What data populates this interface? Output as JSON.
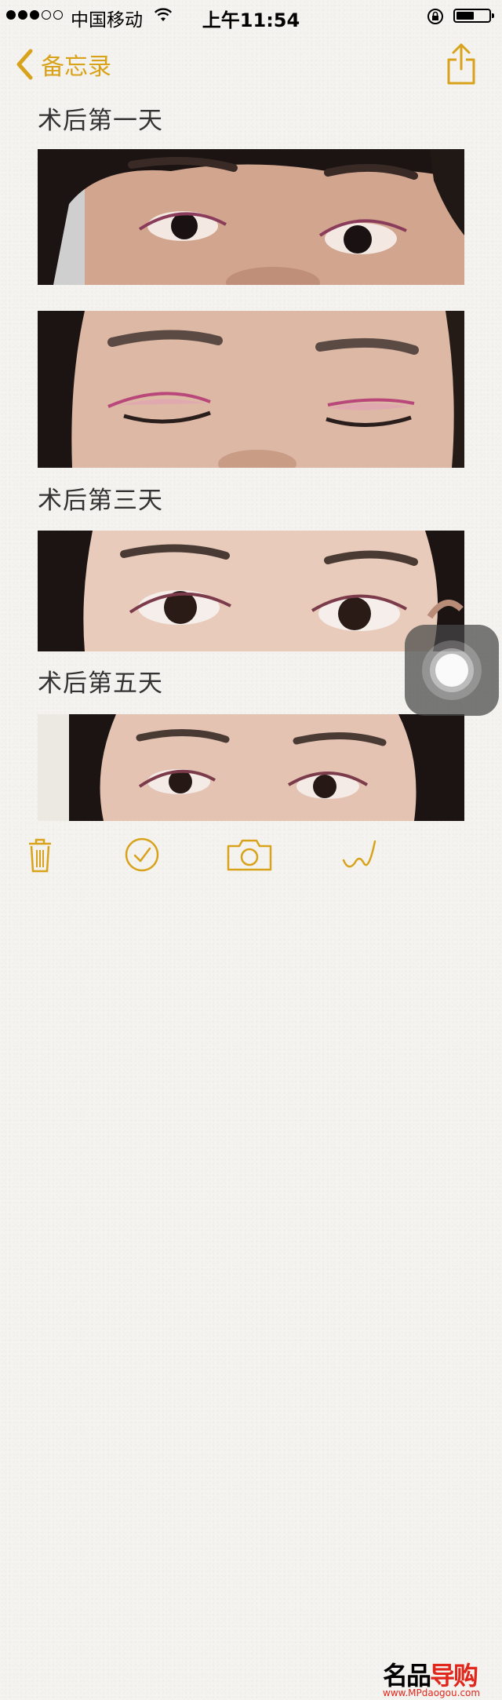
{
  "status_bar": {
    "carrier": "中国移动",
    "time": "上午11:54",
    "signal_bars_filled": 3,
    "signal_bars_total": 5,
    "battery_level": 0.45
  },
  "nav": {
    "back_label": "备忘录",
    "back_icon": "chevron-left-icon",
    "share_icon": "share-icon",
    "accent": "#d9a21b"
  },
  "note": {
    "headings": {
      "day1": "术后第一天",
      "day3": "术后第三天",
      "day5": "术后第五天"
    }
  },
  "toolbar": {
    "icons": [
      "trash-icon",
      "checklist-icon",
      "camera-icon",
      "sketch-icon",
      "compose-icon"
    ]
  },
  "watermark": {
    "logo_text_black": "名品",
    "logo_text_red": "导购",
    "url": "www.MPdaogou.com"
  }
}
